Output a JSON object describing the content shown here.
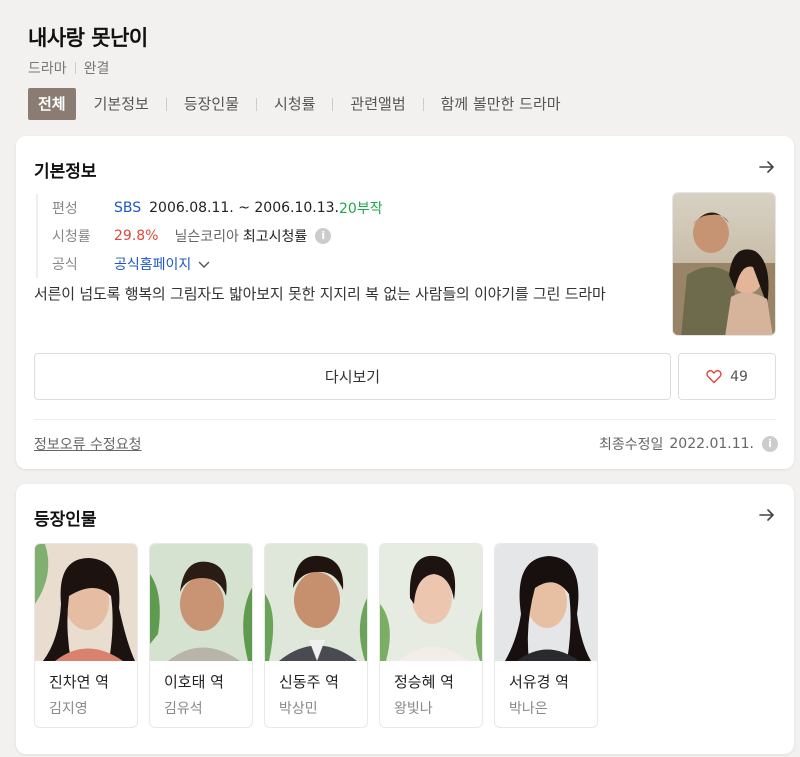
{
  "header": {
    "title": "내사랑 못난이",
    "genre": "드라마",
    "status": "완결",
    "tabs": [
      "전체",
      "기본정보",
      "등장인물",
      "시청률",
      "관련앨범",
      "함께 볼만한 드라마"
    ]
  },
  "basic_info": {
    "section_title": "기본정보",
    "arrow_icon": "arrow-right-icon",
    "broadcast_label": "편성",
    "channel": "SBS",
    "period": "2006.08.11. ~ 2006.10.13.",
    "episodes": "20부작",
    "rating_label": "시청률",
    "rating_value": "29.8%",
    "rating_source": "닐슨코리아",
    "rating_kind": "최고시청률",
    "official_label": "공식",
    "official_link": "공식홈페이지",
    "description": "서른이 넘도록 행복의 그림자도 밟아보지 못한 지지리 복 없는 사람들의 이야기를 그린 드라마",
    "rewatch_label": "다시보기",
    "like_count": "49",
    "report_label": "정보오류 수정요청",
    "updated_label": "최종수정일",
    "updated_date": "2022.01.11.",
    "colors": {
      "channel": "#1f56c8",
      "episodes": "#1fa84a",
      "rating": "#e0463c"
    }
  },
  "cast": {
    "section_title": "등장인물",
    "members": [
      {
        "role": "진차연 역",
        "actor": "김지영"
      },
      {
        "role": "이호태 역",
        "actor": "김유석"
      },
      {
        "role": "신동주 역",
        "actor": "박상민"
      },
      {
        "role": "정승혜 역",
        "actor": "왕빛나"
      },
      {
        "role": "서유경 역",
        "actor": "박나은"
      }
    ]
  }
}
